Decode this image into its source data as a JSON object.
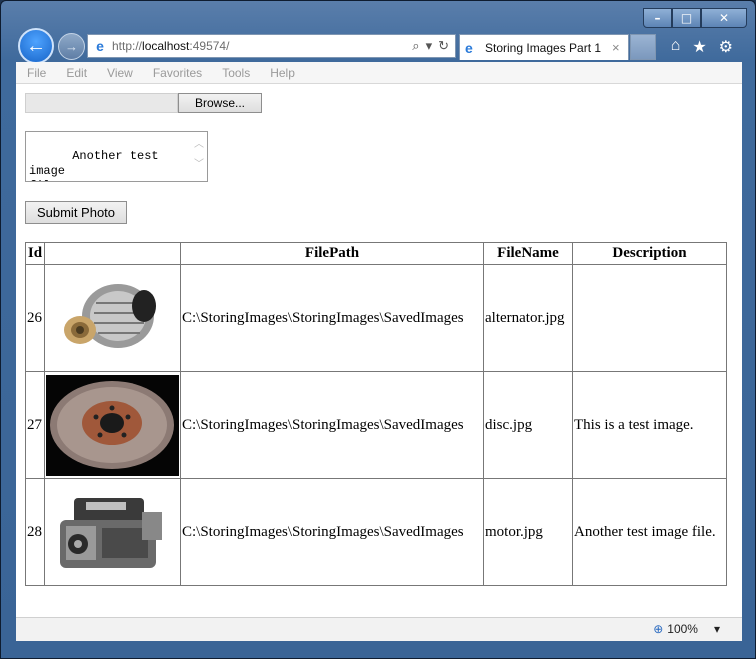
{
  "window": {
    "min_glyph": "–",
    "max_glyph": "□",
    "close_glyph": "✕"
  },
  "nav": {
    "back_glyph": "←",
    "forward_glyph": "→",
    "address_prefix": "http://",
    "address_host": "localhost",
    "address_suffix": ":49574/",
    "search_glyph": "⌕",
    "dropdown_glyph": "▾",
    "refresh_glyph": "↻"
  },
  "tab": {
    "title": "Storing Images Part 1",
    "close_glyph": "×"
  },
  "toolbar": {
    "home_glyph": "⌂",
    "favorites_glyph": "★",
    "settings_glyph": "⚙"
  },
  "menu": [
    "File",
    "Edit",
    "View",
    "Favorites",
    "Tools",
    "Help"
  ],
  "form": {
    "browse_label": "Browse...",
    "description_value": "Another test image\nfile.",
    "submit_label": "Submit Photo"
  },
  "table": {
    "headers": [
      "Id",
      "",
      "FilePath",
      "FileName",
      "Description"
    ],
    "rows": [
      {
        "id": "26",
        "image": "alternator-image",
        "path": "C:\\StoringImages\\StoringImages\\SavedImages",
        "name": "alternator.jpg",
        "description": ""
      },
      {
        "id": "27",
        "image": "brake-disc-image",
        "path": "C:\\StoringImages\\StoringImages\\SavedImages",
        "name": "disc.jpg",
        "description": "This is a test image."
      },
      {
        "id": "28",
        "image": "engine-image",
        "path": "C:\\StoringImages\\StoringImages\\SavedImages",
        "name": "motor.jpg",
        "description": "Another test image file."
      }
    ]
  },
  "status": {
    "zoom": "100%",
    "zoom_dropdown_glyph": "▾"
  },
  "colors": {
    "frame": "#3f6a9c",
    "back_button": "#1764c8",
    "page_bg": "#ffffff"
  }
}
